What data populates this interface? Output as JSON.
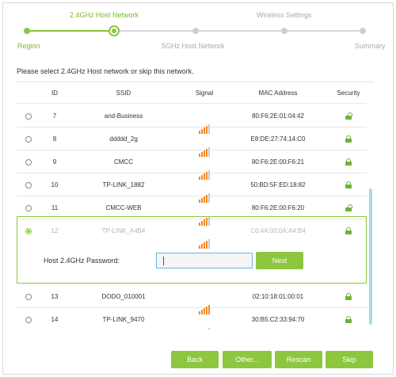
{
  "stepper": {
    "steps_top": [
      "2.4GHz Host Network",
      "Wireless Settings"
    ],
    "steps_bottom": [
      "Region",
      "5GHz Host Network",
      "Summary"
    ],
    "current_step": "2.4GHz Host Network"
  },
  "instruction": "Please select 2.4GHz Host network or skip this network.",
  "table": {
    "headers": {
      "id": "ID",
      "ssid": "SSID",
      "signal": "Signal",
      "mac": "MAC Address",
      "security": "Security"
    },
    "rows": [
      {
        "id": "7",
        "ssid": "and-Business",
        "mac": "80:F6:2E:01:04:42",
        "signal": 4,
        "security": "unlocked"
      },
      {
        "id": "8",
        "ssid": "ddddd_2g",
        "mac": "E8:DE:27:74:14:C0",
        "signal": 4,
        "security": "locked"
      },
      {
        "id": "9",
        "ssid": "CMCC",
        "mac": "80:F6:2E:00:F6:21",
        "signal": 4,
        "security": "locked"
      },
      {
        "id": "10",
        "ssid": "TP-LINK_1882",
        "mac": "50:BD:5F:ED:18:82",
        "signal": 4,
        "security": "locked"
      },
      {
        "id": "11",
        "ssid": "CMCC-WEB",
        "mac": "80:F6:2E:00:F6:20",
        "signal": 4,
        "security": "unlocked"
      },
      {
        "id": "12",
        "ssid": "TP-LINK_A4B4",
        "mac": "C0:4A:00:0A:A4:B4",
        "signal": 4,
        "security": "locked",
        "selected": true
      },
      {
        "id": "13",
        "ssid": "DODO_010001",
        "mac": "02:10:18:01:00:01",
        "signal": 5,
        "security": "locked"
      },
      {
        "id": "14",
        "ssid": "TP-LINK_9470",
        "mac": "30:B5:C2:33:94:70",
        "signal": 2,
        "security": "locked"
      }
    ]
  },
  "password": {
    "label": "Host 2.4GHz Password:",
    "value": "",
    "next_label": "Next"
  },
  "buttons": {
    "back": "Back",
    "other": "Other...",
    "rescan": "Rescan",
    "skip": "Skip"
  },
  "colors": {
    "accent": "#8dc63f",
    "signal": "#f08a24",
    "signal_weak": "#e03a2f",
    "input_border": "#63b7e6"
  }
}
